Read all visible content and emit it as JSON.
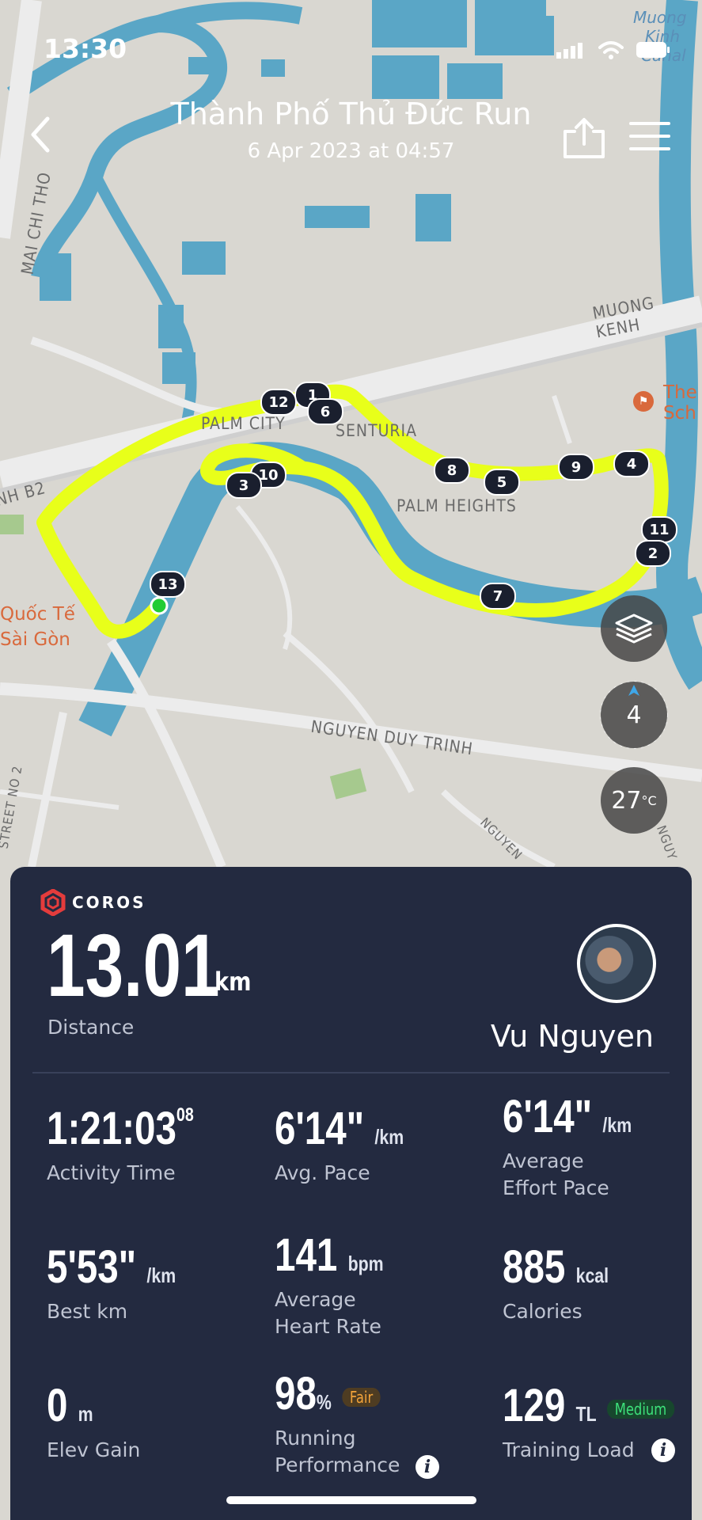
{
  "status_bar": {
    "time": "13:30"
  },
  "header": {
    "title": "Thành Phố Thủ Đức Run",
    "date": "6 Apr 2023 at 04:57"
  },
  "map": {
    "place_labels": {
      "mai_chi_tho": "MAI CHI THO",
      "muong_kenh": "MUONG KENH",
      "palm_city": "PALM CITY",
      "senturia": "SENTURIA",
      "palm_heights": "PALM HEIGHTS",
      "nguyen_duy_trinh": "NGUYEN DUY TRINH",
      "street_no2": "STREET NO 2",
      "b2": "NH B2",
      "nguyen": "NGUYEN",
      "nguy": "NGUY"
    },
    "poi_labels": {
      "school_1": "The",
      "school_2": "Sch",
      "quoc_te": "Quốc Tế",
      "sai_gon": "Sài Gòn"
    },
    "water_labels": {
      "muong_1": "Muong",
      "muong_2": "Kinh",
      "muong_3": "Canal"
    },
    "lap_markers": [
      "1",
      "2",
      "3",
      "4",
      "5",
      "6",
      "7",
      "8",
      "9",
      "10",
      "11",
      "12",
      "13"
    ],
    "compass_value": "4",
    "temperature": "27",
    "temperature_unit": "°C",
    "route_color": "#e8ff1a",
    "start_color": "#22cc33"
  },
  "card": {
    "brand": "COROS",
    "distance": {
      "value": "13.01",
      "unit": "km",
      "label": "Distance"
    },
    "user": {
      "name": "Vu Nguyen"
    },
    "stats": {
      "activity_time": {
        "value": "1:21:03",
        "sup": "08",
        "label": "Activity Time"
      },
      "avg_pace": {
        "value": "6'14\"",
        "unit": "/km",
        "label": "Avg. Pace"
      },
      "effort_pace": {
        "value": "6'14\"",
        "unit": "/km",
        "label_1": "Average",
        "label_2": "Effort Pace"
      },
      "best_km": {
        "value": "5'53\"",
        "unit": "/km",
        "label": "Best km"
      },
      "heart_rate": {
        "value": "141",
        "unit": "bpm",
        "label_1": "Average",
        "label_2": "Heart Rate"
      },
      "calories": {
        "value": "885",
        "unit": "kcal",
        "label": "Calories"
      },
      "elev_gain": {
        "value": "0",
        "unit": "m",
        "label": "Elev Gain"
      },
      "running_performance": {
        "value": "98",
        "unit": "%",
        "badge": "Fair",
        "label_1": "Running",
        "label_2": "Performance"
      },
      "training_load": {
        "value": "129",
        "unit": "TL",
        "badge": "Medium",
        "label": "Training Load"
      }
    }
  }
}
